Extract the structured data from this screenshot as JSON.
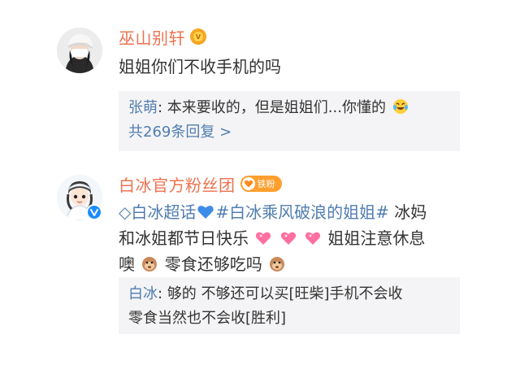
{
  "comments": [
    {
      "username": "巫山别轩",
      "text": "姐姐你们不收手机的吗",
      "reply": {
        "author": "张萌",
        "separator": ": ",
        "text": "本来要收的，但是姐姐们...你懂的"
      },
      "reply_count_label": "共269条回复 >"
    },
    {
      "username": "白冰官方粉丝团",
      "fan_badge": "铁粉",
      "text_parts": {
        "diamond": "◇",
        "topic1": "白冰超话",
        "topic2": "#白冰乘风破浪的姐姐#",
        "line1_tail": " 冰妈",
        "line2_a": "和冰姐都节日快乐 ",
        "line2_b": " 姐姐注意休息",
        "line3_a": "噢 ",
        "line3_b": " 零食还够吃吗 "
      },
      "reply": {
        "author": "白冰",
        "separator": ": ",
        "line1": "够的 不够还可以买[旺柴]手机不会收",
        "line2": "零食当然也不会收[胜利]"
      }
    }
  ],
  "colors": {
    "username": "#eb7350",
    "link": "#507daf",
    "text": "#333333",
    "reply_bg": "#f4f4f6"
  }
}
